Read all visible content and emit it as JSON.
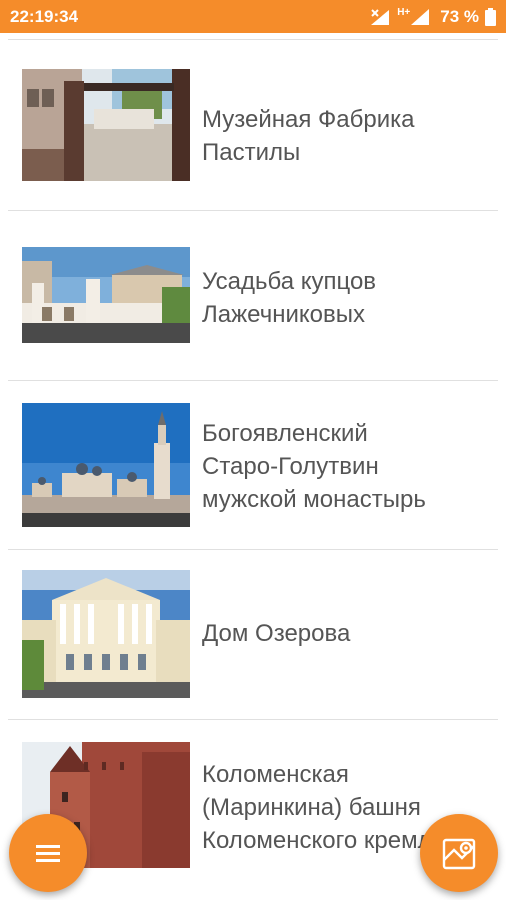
{
  "status_bar": {
    "time": "22:19:34",
    "signal_label": "H+",
    "battery": "73 %"
  },
  "items": [
    {
      "title": "Музейная Фабрика\nПастилы",
      "image_icon": "museum-gate-photo"
    },
    {
      "title": "Усадьба купцов\nЛажечниковых",
      "image_icon": "manor-photo"
    },
    {
      "title": "Богоявленский\nСтаро-Голутвин\nмужской монастырь",
      "image_icon": "monastery-photo"
    },
    {
      "title": "Дом Озерова",
      "image_icon": "ozerov-house-photo"
    },
    {
      "title": "Коломенская\n(Маринкина) башня\nКоломенского кремля",
      "image_icon": "tower-photo"
    }
  ],
  "fab": {
    "menu_icon": "hamburger-menu-icon",
    "map_icon": "map-icon"
  },
  "colors": {
    "accent": "#f58c2a",
    "text": "#555555",
    "divider": "#e0e0e0"
  }
}
